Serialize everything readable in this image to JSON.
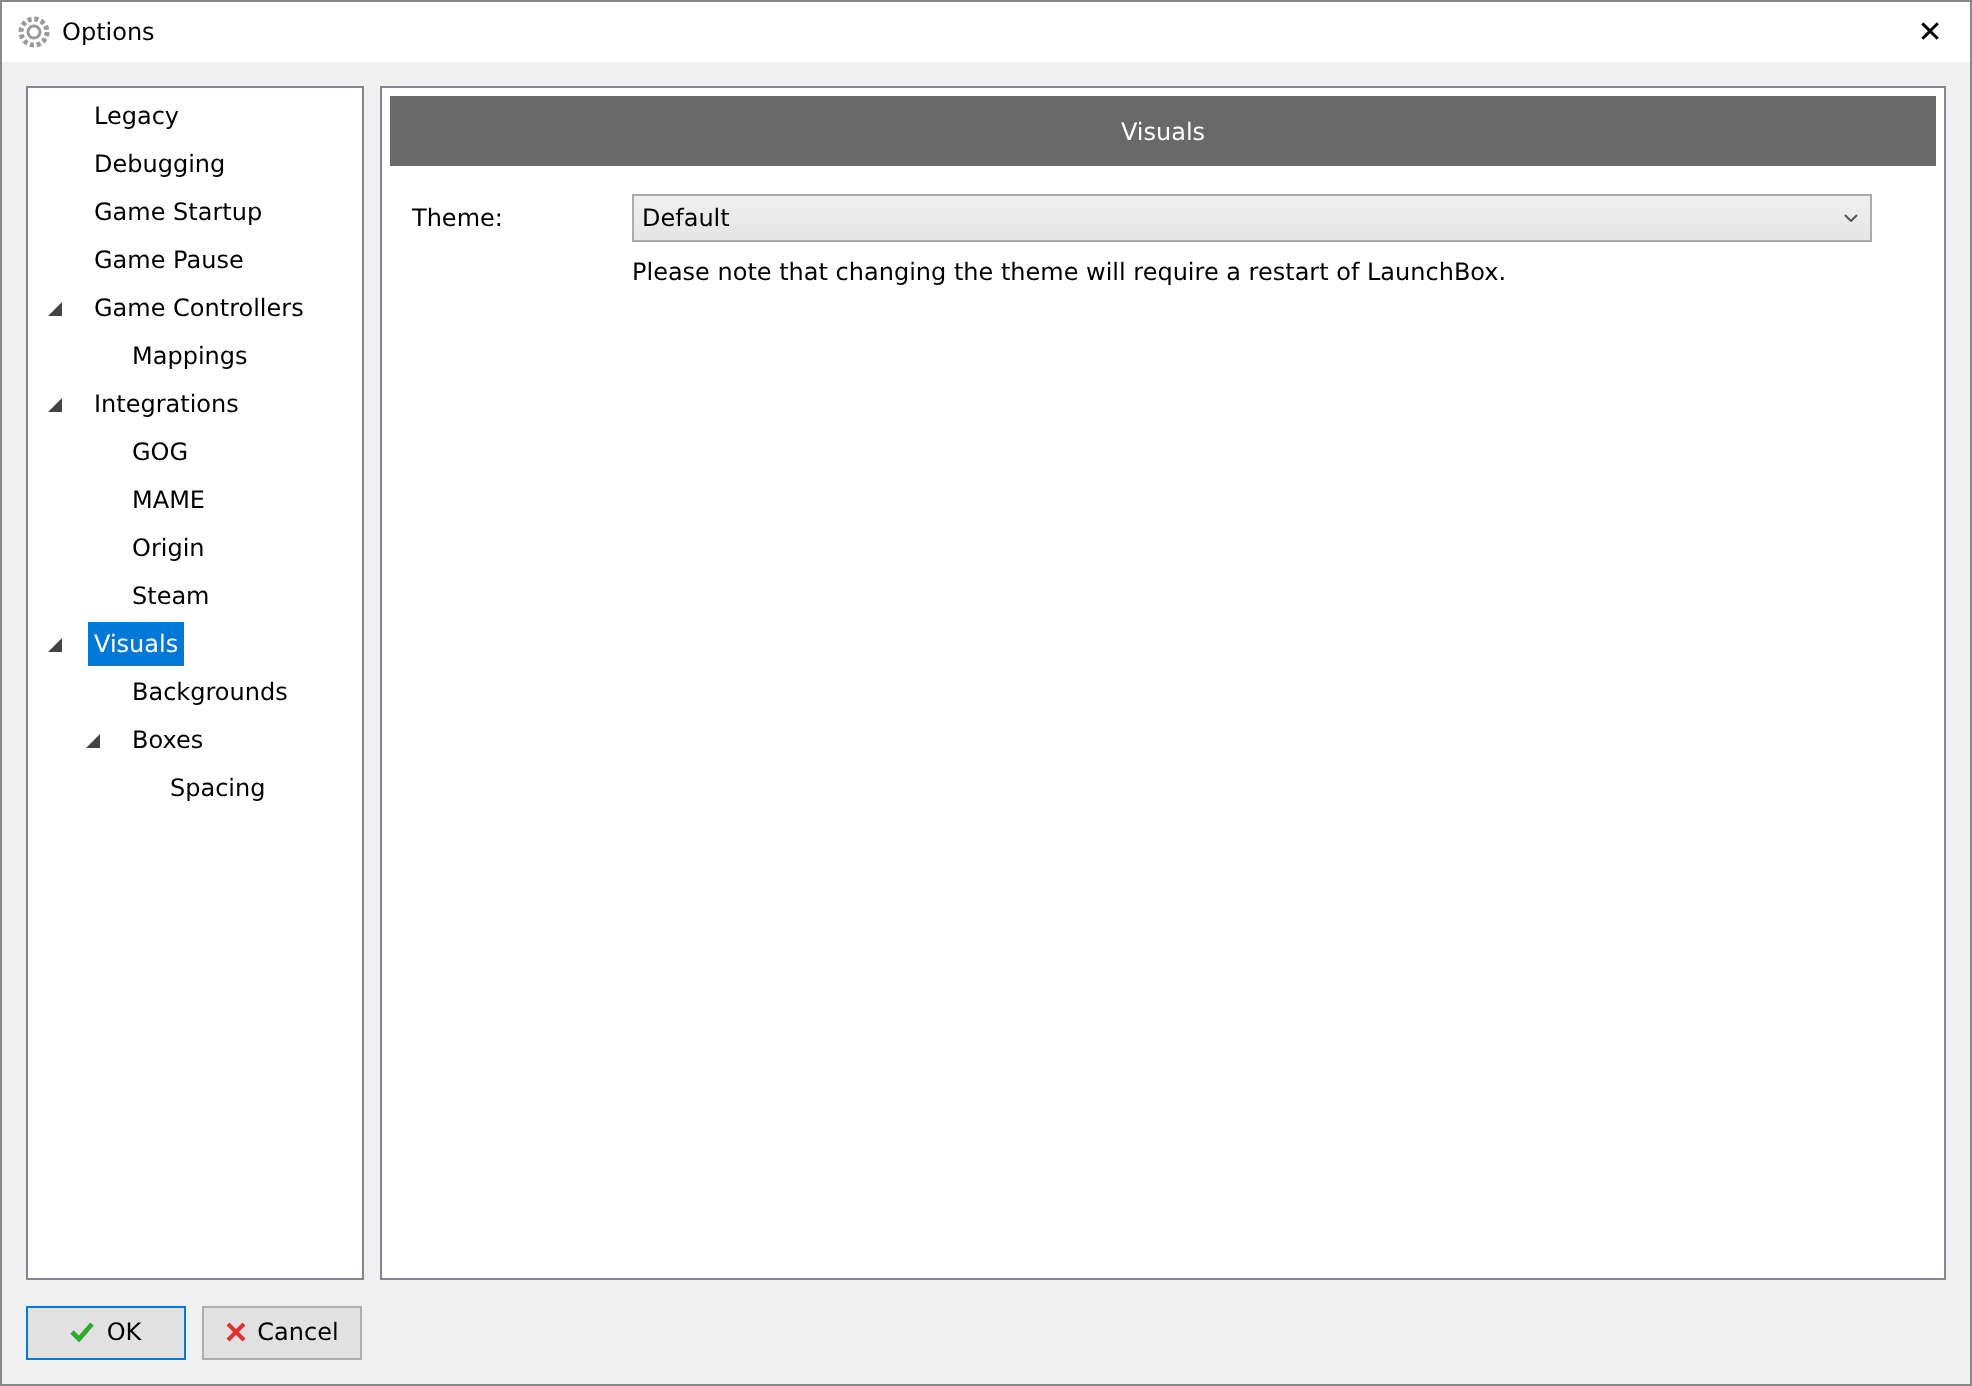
{
  "window": {
    "title": "Options",
    "close": "✕"
  },
  "tree": [
    {
      "label": "Legacy",
      "selected": false
    },
    {
      "label": "Debugging",
      "selected": false
    },
    {
      "label": "Game Startup",
      "selected": false
    },
    {
      "label": "Game Pause",
      "selected": false
    },
    {
      "label": "Game Controllers",
      "selected": false,
      "expanded": true,
      "children": [
        {
          "label": "Mappings",
          "selected": false
        }
      ]
    },
    {
      "label": "Integrations",
      "selected": false,
      "expanded": true,
      "children": [
        {
          "label": "GOG",
          "selected": false
        },
        {
          "label": "MAME",
          "selected": false
        },
        {
          "label": "Origin",
          "selected": false
        },
        {
          "label": "Steam",
          "selected": false
        }
      ]
    },
    {
      "label": "Visuals",
      "selected": true,
      "expanded": true,
      "children": [
        {
          "label": "Backgrounds",
          "selected": false
        },
        {
          "label": "Boxes",
          "selected": false,
          "expanded": true,
          "children": [
            {
              "label": "Spacing",
              "selected": false
            }
          ]
        }
      ]
    }
  ],
  "panel": {
    "header": "Visuals",
    "theme_label": "Theme:",
    "theme_value": "Default",
    "note": "Please note that changing the theme will require a restart of LaunchBox."
  },
  "buttons": [
    {
      "kind": "ok",
      "label": "OK"
    },
    {
      "kind": "cancel",
      "label": "Cancel"
    }
  ]
}
